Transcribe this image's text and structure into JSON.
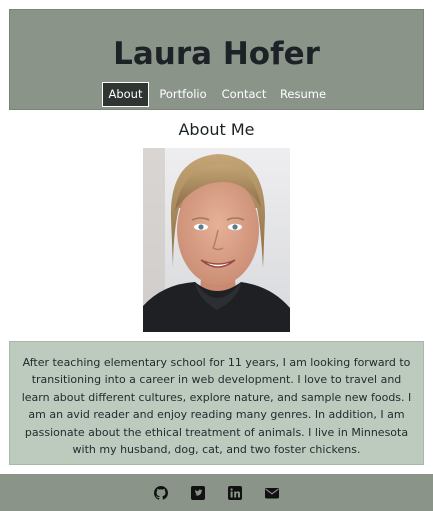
{
  "header": {
    "title": "Laura Hofer",
    "nav": [
      {
        "label": "About",
        "active": true
      },
      {
        "label": "Portfolio",
        "active": false
      },
      {
        "label": "Contact",
        "active": false
      },
      {
        "label": "Resume",
        "active": false
      }
    ]
  },
  "about": {
    "heading": "About Me",
    "photo_icon": "portrait-photo",
    "bio": "After teaching elementary school for 11 years, I am looking forward to transitioning into a career in web development. I love to travel and learn about different cultures, explore nature, and sample new foods. I am an avid reader and enjoy reading many genres. In addition, I am passionate about the ethical treatment of animals. I live in Minnesota with my husband, dog, cat, and two foster chickens."
  },
  "footer": {
    "icons": [
      "github-icon",
      "twitter-icon",
      "linkedin-icon",
      "envelope-icon"
    ]
  },
  "colors": {
    "header_bg": "#8a9489",
    "bio_bg": "#bccbbd",
    "active_nav_bg": "#2f3532",
    "title_text": "#1c2226"
  }
}
